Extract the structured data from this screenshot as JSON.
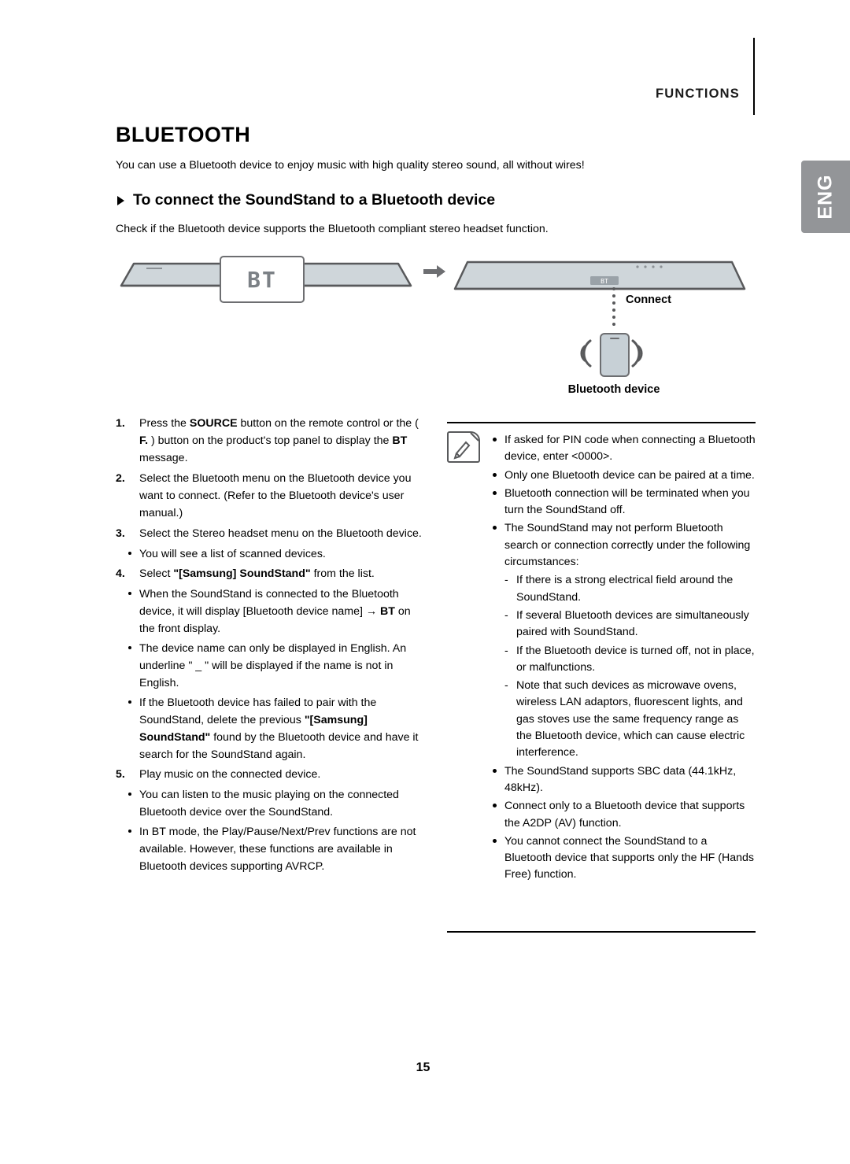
{
  "header": {
    "section_label": "FUNCTIONS",
    "lang_tab": "ENG"
  },
  "page": {
    "title": "BLUETOOTH",
    "intro": "You can use a Bluetooth device to enjoy music with high quality stereo sound, all without wires!",
    "section_title": "To connect the SoundStand to a Bluetooth device",
    "check_text": "Check if the Bluetooth device supports the Bluetooth compliant stereo headset function.",
    "page_number": "15"
  },
  "illustration": {
    "bt_display": "BT",
    "bar_display": "BT",
    "connect_label": "Connect",
    "device_label": "Bluetooth device",
    "arrow_icon": "right-arrow-icon",
    "phone_icon": "smartphone-icon",
    "wave_left_icon": "signal-wave-left-icon",
    "wave_right_icon": "signal-wave-right-icon"
  },
  "steps": [
    {
      "num": "1.",
      "html": "Press the <b>SOURCE</b> button on the remote control or the ( <b>F.</b> ) button on the product's top panel to display the <b>BT</b> message.",
      "subs": []
    },
    {
      "num": "2.",
      "html": "Select the Bluetooth menu on the Bluetooth device you want to connect. (Refer to the Bluetooth device's user manual.)",
      "subs": []
    },
    {
      "num": "3.",
      "html": "Select the Stereo headset menu on the Bluetooth device.",
      "subs": [
        "You will see a list of scanned devices."
      ]
    },
    {
      "num": "4.",
      "html": "Select <b>\"[Samsung] SoundStand\"</b> from the list.",
      "subs": [
        "When the SoundStand is connected to the Bluetooth device, it will display [Bluetooth device name] &#8594; <b>BT</b> on the front display.",
        "The device name can only be displayed in English. An underline \" _ \" will be displayed if the name is not in English.",
        "If the Bluetooth device has failed to pair with the SoundStand, delete the previous <b>\"[Samsung] SoundStand\"</b> found by the Bluetooth device and have it search for the SoundStand again."
      ]
    },
    {
      "num": "5.",
      "html": "Play music on the connected device.",
      "subs": [
        "You can listen to the music playing on the connected Bluetooth device over the SoundStand.",
        "In BT mode, the Play/Pause/Next/Prev functions are not available. However, these functions are available in Bluetooth devices supporting AVRCP."
      ]
    }
  ],
  "notes": {
    "icon": "note-icon",
    "items": [
      {
        "type": "bullet",
        "text": "If asked for PIN code when connecting a Bluetooth device, enter <0000>."
      },
      {
        "type": "bullet",
        "text": "Only one Bluetooth device can be paired at a time."
      },
      {
        "type": "bullet",
        "text": "Bluetooth connection will be terminated when you turn the SoundStand off."
      },
      {
        "type": "bullet",
        "text": "The SoundStand may not perform Bluetooth search or connection correctly under the following circumstances:"
      },
      {
        "type": "dash",
        "text": "If there is a strong electrical field around the SoundStand."
      },
      {
        "type": "dash",
        "text": "If several Bluetooth devices are simultaneously paired with SoundStand."
      },
      {
        "type": "dash",
        "text": "If the Bluetooth device is turned off, not in place, or malfunctions."
      },
      {
        "type": "dash",
        "text": "Note that such devices as microwave ovens, wireless LAN adaptors, fluorescent lights, and gas stoves use the same frequency range as the Bluetooth device, which can cause electric interference."
      },
      {
        "type": "bullet",
        "text": "The SoundStand supports SBC data (44.1kHz, 48kHz)."
      },
      {
        "type": "bullet",
        "text": "Connect only to a Bluetooth device that supports the A2DP (AV) function."
      },
      {
        "type": "bullet",
        "text": "You cannot connect the SoundStand to a Bluetooth device that supports only the HF (Hands Free) function."
      }
    ]
  }
}
